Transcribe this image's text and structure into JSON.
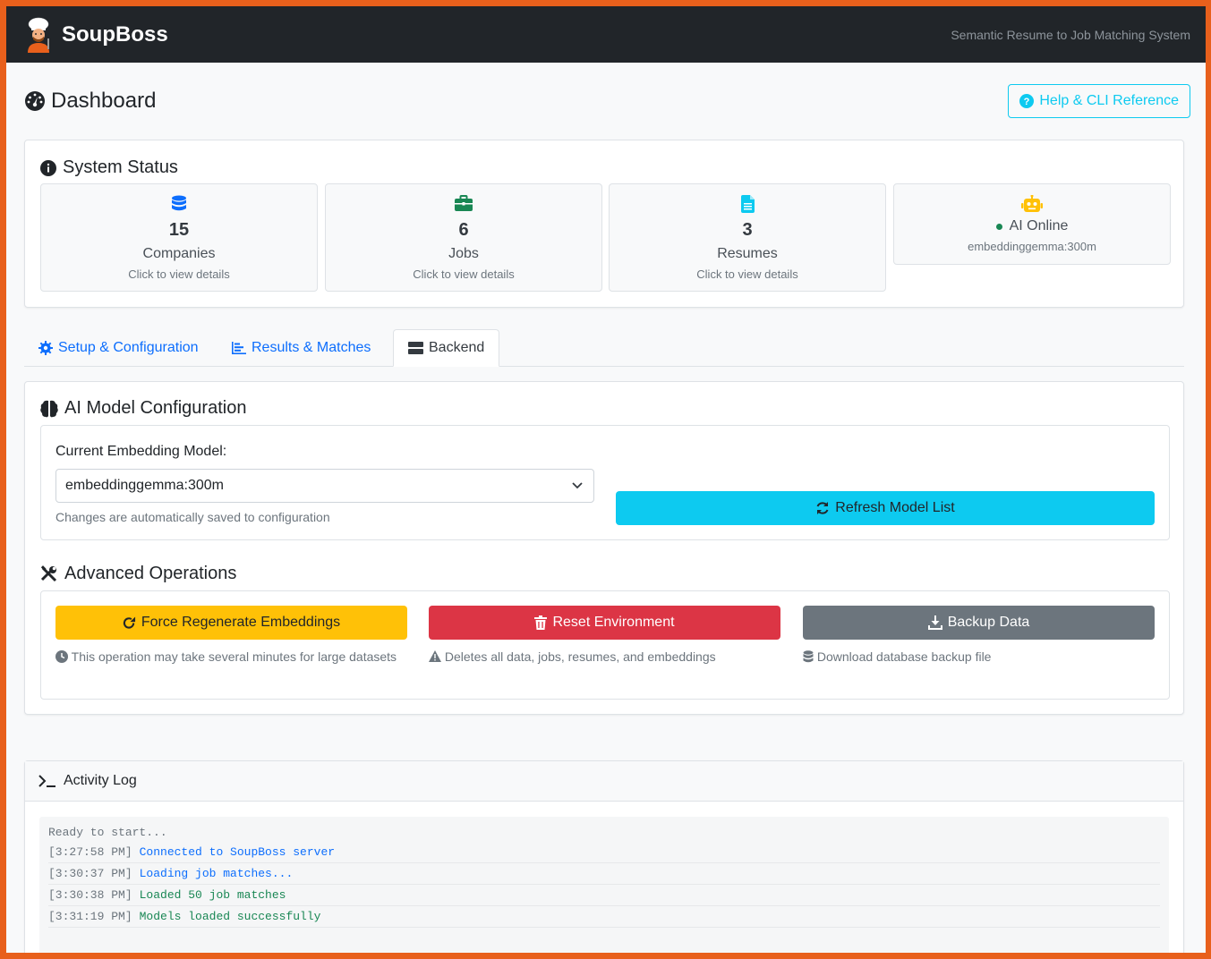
{
  "navbar": {
    "brand": "SoupBoss",
    "tagline": "Semantic Resume to Job Matching System"
  },
  "header": {
    "title": "Dashboard",
    "help_label": "Help & CLI Reference"
  },
  "status": {
    "title": "System Status",
    "companies": {
      "count": "15",
      "label": "Companies",
      "sub": "Click to view details"
    },
    "jobs": {
      "count": "6",
      "label": "Jobs",
      "sub": "Click to view details"
    },
    "resumes": {
      "count": "3",
      "label": "Resumes",
      "sub": "Click to view details"
    },
    "ai": {
      "status": "AI Online",
      "model": "embeddinggemma:300m"
    }
  },
  "tabs": {
    "setup": "Setup & Configuration",
    "results": "Results & Matches",
    "backend": "Backend"
  },
  "backend": {
    "model_section_title": "AI Model Configuration",
    "current_model_label": "Current Embedding Model:",
    "selected_model": "embeddinggemma:300m",
    "hint": "Changes are automatically saved to configuration",
    "refresh_label": "Refresh Model List",
    "ops_title": "Advanced Operations",
    "regen_label": "Force Regenerate Embeddings",
    "regen_note": "This operation may take several minutes for large datasets",
    "reset_label": "Reset Environment",
    "reset_note": "Deletes all data, jobs, resumes, and embeddings",
    "backup_label": "Backup Data",
    "backup_note": "Download database backup file"
  },
  "log": {
    "title": "Activity Log",
    "first": "Ready to start...",
    "entries": [
      {
        "time": "[3:27:58 PM]",
        "msg": "Connected to SoupBoss server"
      },
      {
        "time": "[3:30:37 PM]",
        "msg": "Loading job matches..."
      },
      {
        "time": "[3:30:38 PM]",
        "msg": "Loaded 50 job matches"
      },
      {
        "time": "[3:31:19 PM]",
        "msg": "Models loaded successfully"
      }
    ]
  },
  "colors": {
    "primary": "#0d6efd",
    "info": "#0dcaf0",
    "warning": "#ffc107",
    "danger": "#dc3545",
    "secondary": "#6c757d",
    "success": "#198754"
  }
}
